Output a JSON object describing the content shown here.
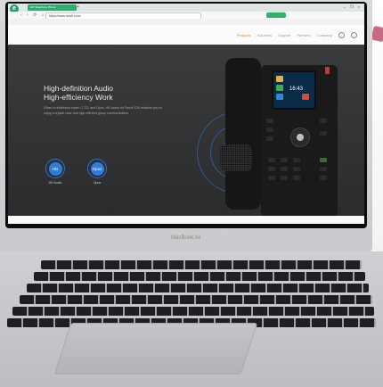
{
  "browser": {
    "logo_letter": "e",
    "tab_title": "HD Telephone Phone",
    "new_tab": "+",
    "window_controls": "– ❐ ×",
    "nav_buttons": "‹ › ⟳ ⌂",
    "url": "https://www.fanvil.com/",
    "green_badge": "",
    "address_right": "",
    "bookmarks": [
      "",
      ""
    ],
    "bookmarks_right": ""
  },
  "site": {
    "nav": [
      {
        "label": "Products",
        "active": true
      },
      {
        "label": "Solutions",
        "active": false
      },
      {
        "label": "Support",
        "active": false
      },
      {
        "label": "Partners",
        "active": false
      },
      {
        "label": "Company",
        "active": false
      }
    ],
    "hero": {
      "title_line1": "High-definition Audio",
      "title_line2": "High-efficiency Work",
      "description": "Given to wideband codec G.722 and Opus, HD audio on Fanvil X3U enables you to enjoy a crystal clear and high efficient group communication."
    },
    "features": [
      {
        "icon": "hd-icon",
        "badge": "HD",
        "label": "HD Audio"
      },
      {
        "icon": "opus-icon",
        "badge": "Opus",
        "label": "Opus"
      }
    ],
    "phone": {
      "lcd_time": "16:43"
    }
  },
  "laptop": {
    "brand": "MacBook Air"
  },
  "colors": {
    "accent": "#2f7ce0",
    "nav_active": "#e57d3a",
    "browser_green": "#27b06e",
    "hero_bg": "#333436"
  }
}
